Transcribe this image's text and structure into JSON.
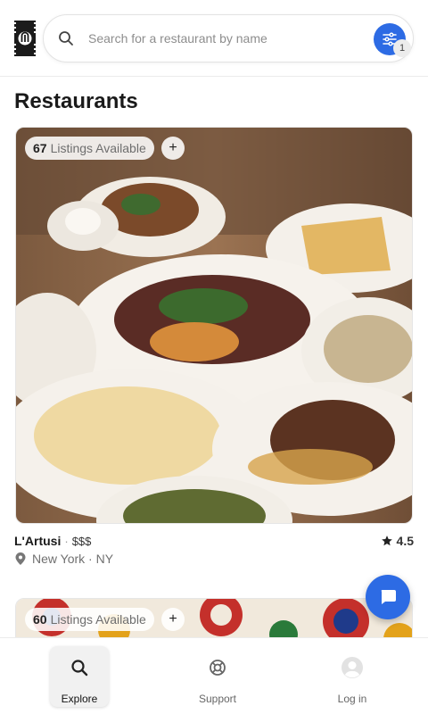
{
  "header": {
    "search": {
      "placeholder": "Search for a restaurant by name",
      "value": ""
    },
    "filter": {
      "badge_count": "1"
    }
  },
  "page": {
    "title": "Restaurants"
  },
  "restaurants": [
    {
      "listings_count": "67",
      "listings_label": "Listings Available",
      "plus_label": "+",
      "name": "L'Artusi",
      "separator": "·",
      "price": "$$$",
      "rating": "4.5",
      "location": "New York · NY"
    },
    {
      "listings_count": "60",
      "listings_label": "Listings Available",
      "plus_label": "+"
    }
  ],
  "nav": {
    "explore": "Explore",
    "support": "Support",
    "login": "Log in"
  },
  "colors": {
    "accent": "#2d6be4",
    "nav_active_bg": "#f1f1f1"
  },
  "icons": [
    "logo-icon",
    "search-icon",
    "filter-icon",
    "star-icon",
    "location-pin-icon",
    "chat-icon",
    "search-nav-icon",
    "lifebuoy-icon",
    "user-avatar-icon"
  ]
}
